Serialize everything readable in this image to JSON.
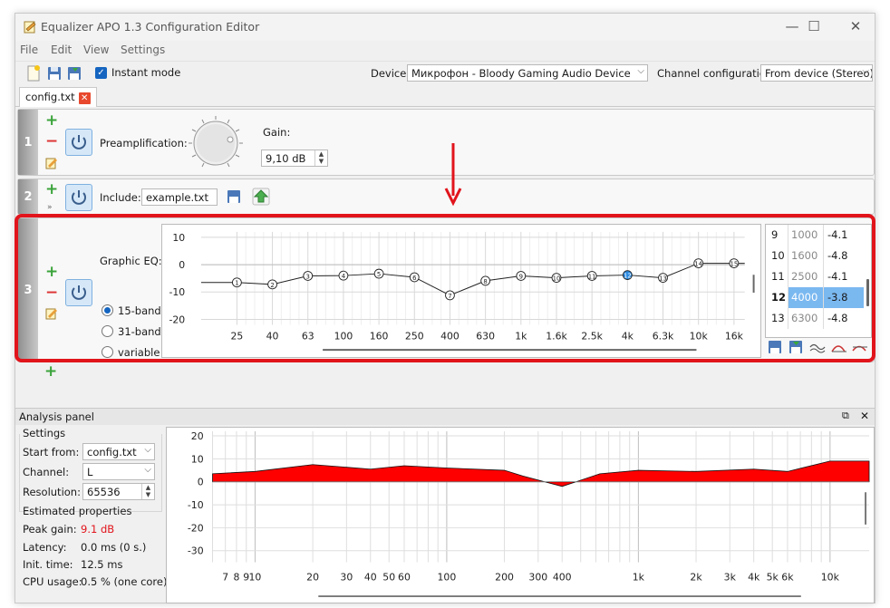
{
  "window": {
    "title": "Equalizer APO 1.3 Configuration Editor",
    "minimize": "—",
    "maximize": "☐",
    "close": "✕"
  },
  "menu": [
    "File",
    "Edit",
    "View",
    "Settings"
  ],
  "toolbar": {
    "instant_mode_label": "Instant mode",
    "device_label": "Device:",
    "device_value": "Микрофон - Bloody Gaming Audio Device",
    "channel_config_label": "Channel configuration:",
    "channel_config_value": "From device (Stereo)"
  },
  "tab": {
    "label": "config.txt"
  },
  "filters": [
    {
      "number": "1",
      "label": "Preamplification:",
      "gain_label": "Gain:",
      "gain_value": "9,10 dB"
    },
    {
      "number": "2",
      "label": "Include:",
      "value": "example.txt"
    },
    {
      "number": "3",
      "label": "Graphic EQ:",
      "options": [
        "15-band",
        "31-band",
        "variable"
      ],
      "selected": "15-band"
    }
  ],
  "graphic_eq": {
    "y_ticks": [
      "10",
      "0",
      "-10",
      "-20"
    ],
    "ylim": [
      -22,
      12
    ],
    "x_ticks": [
      "25",
      "40",
      "63",
      "100",
      "160",
      "250",
      "400",
      "630",
      "1k",
      "1.6k",
      "2.5k",
      "4k",
      "6.3k",
      "10k",
      "16k"
    ],
    "points": [
      {
        "n": "1",
        "gain": -6.5
      },
      {
        "n": "2",
        "gain": -7.2
      },
      {
        "n": "3",
        "gain": -4.1
      },
      {
        "n": "4",
        "gain": -4.0
      },
      {
        "n": "5",
        "gain": -3.3
      },
      {
        "n": "6",
        "gain": -4.6
      },
      {
        "n": "7",
        "gain": -11.2
      },
      {
        "n": "8",
        "gain": -5.9
      },
      {
        "n": "9",
        "gain": -4.1
      },
      {
        "n": "10",
        "gain": -4.8
      },
      {
        "n": "11",
        "gain": -4.1
      },
      {
        "n": "12",
        "gain": -3.8
      },
      {
        "n": "13",
        "gain": -4.8
      },
      {
        "n": "14",
        "gain": 0.5
      },
      {
        "n": "15",
        "gain": 0.5
      }
    ],
    "selected_point": "12"
  },
  "band_table": [
    {
      "index": "9",
      "freq": "1000",
      "gain": "-4.1"
    },
    {
      "index": "10",
      "freq": "1600",
      "gain": "-4.8"
    },
    {
      "index": "11",
      "freq": "2500",
      "gain": "-4.1"
    },
    {
      "index": "12",
      "freq": "4000",
      "gain": "-3.8",
      "selected": true
    },
    {
      "index": "13",
      "freq": "6300",
      "gain": "-4.8"
    }
  ],
  "analysis": {
    "title": "Analysis panel",
    "settings_title": "Settings",
    "start_from_label": "Start from:",
    "start_from_value": "config.txt",
    "channel_label": "Channel:",
    "channel_value": "L",
    "resolution_label": "Resolution:",
    "resolution_value": "65536",
    "estimated_title": "Estimated properties",
    "peak_gain_label": "Peak gain:",
    "peak_gain_value": "9.1 dB",
    "latency_label": "Latency:",
    "latency_value": "0.0 ms (0 s.)",
    "init_time_label": "Init. time:",
    "init_time_value": "12.5 ms",
    "cpu_label": "CPU usage:",
    "cpu_value": "0.5 % (one core)",
    "peak_color": "#e1141c"
  },
  "chart_data": {
    "type": "area",
    "y_ticks": [
      "20",
      "10",
      "0",
      "-10",
      "-20",
      "-30"
    ],
    "ylim": [
      -35,
      22
    ],
    "x_ticks": [
      "7",
      "8",
      "9",
      "10",
      "20",
      "30",
      "40",
      "50",
      "60",
      "100",
      "200",
      "300",
      "400",
      "1k",
      "2k",
      "3k",
      "4k",
      "5k",
      "6k",
      "10k"
    ],
    "xlim": [
      6,
      16000
    ],
    "x": [
      6,
      10,
      20,
      40,
      60,
      100,
      200,
      250,
      400,
      630,
      1000,
      2000,
      4000,
      6000,
      10000,
      16000
    ],
    "values": [
      3.5,
      4.5,
      7.5,
      5.5,
      7.0,
      6.0,
      5.0,
      2.5,
      -2.0,
      3.5,
      5.0,
      4.5,
      5.5,
      4.5,
      9.0,
      9.0
    ],
    "fill_color": "#ff0000"
  }
}
